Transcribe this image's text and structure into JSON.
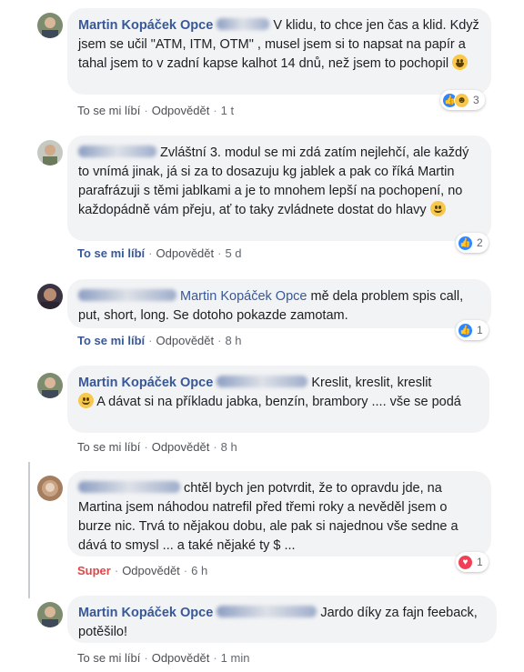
{
  "comments": [
    {
      "author": "Martin Kopáček Opce",
      "text": "V klidu, to chce jen čas a klid. Když jsem se učil \"ATM, ITM, OTM\" , musel jsem si to napsat na papír a tahal jsem to v zadní kapse kalhot 14 dnů, než jsem to pochopil",
      "actions": {
        "like": "To se mi líbí",
        "reply": "Odpovědět",
        "time": "1 t"
      },
      "reactions_count": "3"
    },
    {
      "author": "Vít Navrátil",
      "text": "Zvláštní 3. modul se mi zdá zatím nejlehčí, ale každý to vnímá jinak, já si za to dosazuju kg jablek a pak co říká Martin parafrázuji s těmi jablkami a je to mnohem lepší na pochopení, no každopádně vám přeju, ať to taky zvládnete dostat do hlavy",
      "actions": {
        "like": "To se mi líbí",
        "reply": "Odpovědět",
        "time": "5 d"
      },
      "reactions_count": "2"
    },
    {
      "author": "Pavel Hradecký",
      "mention": "Martin Kopáček Opce",
      "text": "mě dela problem spis call, put, short, long. Se dotoho pokazde zamotam.",
      "actions": {
        "like": "To se mi líbí",
        "reply": "Odpovědět",
        "time": "8 h"
      },
      "reactions_count": "1"
    },
    {
      "author": "Martin Kopáček Opce",
      "text_a": "Kreslit, kreslit, kreslit",
      "text_b": "A dávat si na příkladu jabka, benzín, brambory .... vše se podá",
      "actions": {
        "like": "To se mi líbí",
        "reply": "Odpovědět",
        "time": "8 h"
      }
    },
    {
      "author": "Jaroslav Slegr",
      "text": "chtěl bych jen potvrdit, že to opravdu jde, na Martina jsem náhodou natrefil před třemi roky a nevěděl jsem o burze nic. Trvá to nějakou dobu, ale pak si najednou vše sedne a dává to smysl ... a také nějaké ty $ ...",
      "actions": {
        "like": "Super",
        "reply": "Odpovědět",
        "time": "6 h"
      },
      "reactions_count": "1"
    },
    {
      "author": "Martin Kopáček Opce",
      "mention": "Jaroslav Slegr",
      "text": "Jardo díky za fajn feeback, potěšilo!",
      "actions": {
        "like": "To se mi líbí",
        "reply": "Odpovědět",
        "time": "1 min"
      }
    }
  ],
  "colors": {
    "link": "#385898",
    "bubble": "#f2f3f5",
    "like": "#2d88ff",
    "love": "#f33e58"
  }
}
